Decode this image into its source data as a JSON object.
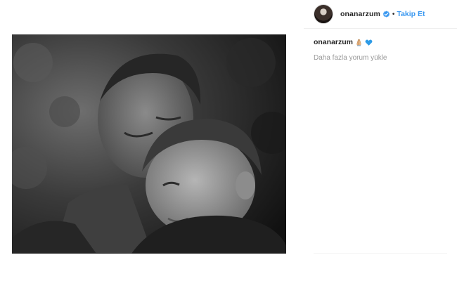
{
  "post": {
    "image_alt": "black and white photo of a man and a young child resting cheek to cheek",
    "author": {
      "username": "onanarzum",
      "verified": true,
      "separator": "•",
      "follow_label": "Takip Et"
    },
    "caption": {
      "username": "onanarzum",
      "emojis": [
        "praying-hands",
        "blue-heart"
      ]
    },
    "load_more_label": "Daha fazla yorum yükle"
  },
  "colors": {
    "link_blue": "#3897f0",
    "text_dark": "#262626",
    "text_muted": "#999999",
    "verified_blue": "#3897f0",
    "heart_blue": "#2e9be6"
  }
}
